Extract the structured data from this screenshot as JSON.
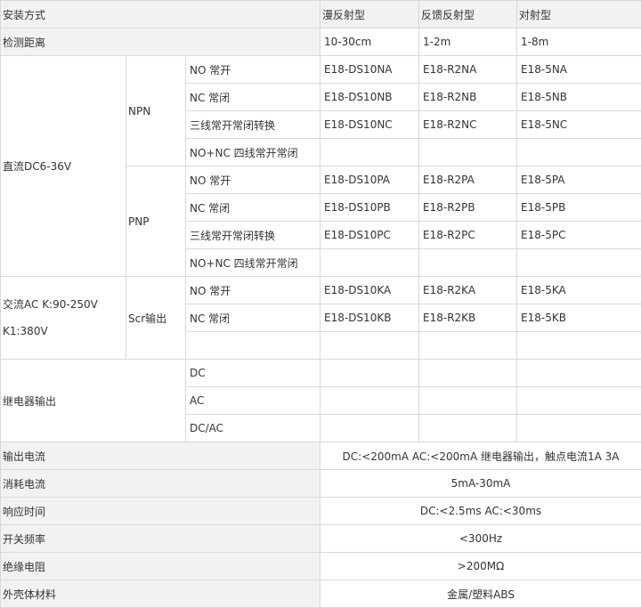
{
  "header": {
    "install_method": "安装方式",
    "diffuse": "漫反射型",
    "retro": "反馈反射型",
    "through": "对射型"
  },
  "distance": {
    "label": "检测距离",
    "diffuse": "10-30cm",
    "retro": "1-2m",
    "through": "1-8m"
  },
  "dc": {
    "label": "直流DC6-36V",
    "npn": {
      "label": "NPN",
      "rows": [
        {
          "output": "NO 常开",
          "diffuse": "E18-DS10NA",
          "retro": "E18-R2NA",
          "through": "E18-5NA"
        },
        {
          "output": "NC 常闭",
          "diffuse": "E18-DS10NB",
          "retro": "E18-R2NB",
          "through": "E18-5NB"
        },
        {
          "output": "三线常开常闭转换",
          "diffuse": "E18-DS10NC",
          "retro": "E18-R2NC",
          "through": "E18-5NC"
        },
        {
          "output": "NO+NC 四线常开常闭",
          "diffuse": "",
          "retro": "",
          "through": ""
        }
      ]
    },
    "pnp": {
      "label": "PNP",
      "rows": [
        {
          "output": "NO 常开",
          "diffuse": "E18-DS10PA",
          "retro": "E18-R2PA",
          "through": "E18-5PA"
        },
        {
          "output": "NC 常闭",
          "diffuse": "E18-DS10PB",
          "retro": "E18-R2PB",
          "through": "E18-5PB"
        },
        {
          "output": "三线常开常闭转换",
          "diffuse": "E18-DS10PC",
          "retro": "E18-R2PC",
          "through": "E18-5PC"
        },
        {
          "output": "NO+NC 四线常开常闭",
          "diffuse": "",
          "retro": "",
          "through": ""
        }
      ]
    }
  },
  "ac": {
    "label_line1": "交流AC K:90-250V",
    "label_line2": "K1:380V",
    "scr": {
      "label": "Scr输出",
      "rows": [
        {
          "output": "NO 常开",
          "diffuse": "E18-DS10KA",
          "retro": "E18-R2KA",
          "through": "E18-5KA"
        },
        {
          "output": "NC 常闭",
          "diffuse": "E18-DS10KB",
          "retro": "E18-R2KB",
          "through": "E18-5KB"
        },
        {
          "output": "",
          "diffuse": "",
          "retro": "",
          "through": ""
        }
      ]
    }
  },
  "relay": {
    "label": "继电器输出",
    "rows": [
      {
        "output": "DC"
      },
      {
        "output": "AC"
      },
      {
        "output": "DC/AC"
      }
    ]
  },
  "specs": [
    {
      "label": "输出电流",
      "value": "DC:<200mA AC:<200mA 继电器输出，触点电流1A 3A"
    },
    {
      "label": "消耗电流",
      "value": "5mA-30mA"
    },
    {
      "label": "响应时间",
      "value": "DC:<2.5ms AC:<30ms"
    },
    {
      "label": "开关频率",
      "value": "<300Hz"
    },
    {
      "label": "绝缘电阻",
      "value": ">200MΩ"
    },
    {
      "label": "外壳体材料",
      "value": "金属/塑料ABS"
    }
  ]
}
